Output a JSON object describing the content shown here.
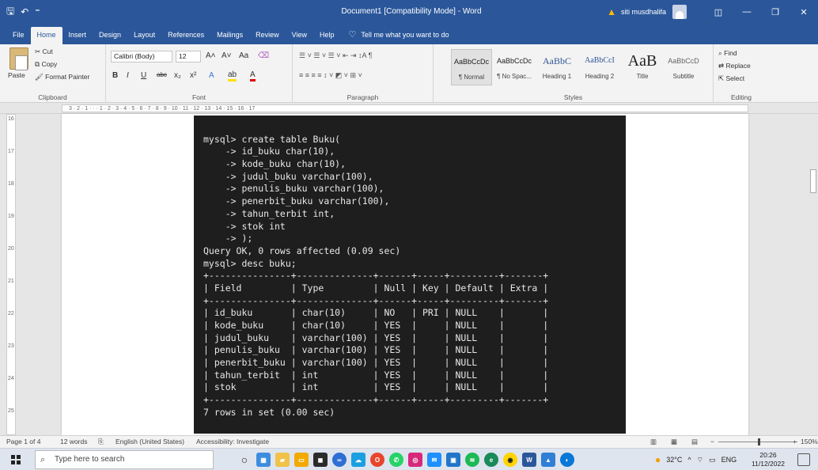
{
  "titlebar": {
    "qat_save": "🖫",
    "qat_undo": "↶",
    "qat_more": "⁼",
    "document_title": "Document1 [Compatibility Mode] - Word",
    "warning_icon": "▲",
    "user_name": "siti musdhalifa",
    "ribbon_display_icon": "◫",
    "minimize": "—",
    "restore": "❐",
    "close": "✕"
  },
  "tabs": [
    "File",
    "Home",
    "Insert",
    "Design",
    "Layout",
    "References",
    "Mailings",
    "Review",
    "View",
    "Help"
  ],
  "active_tab": "Home",
  "tellme": {
    "icon": "♡",
    "text": "Tell me what you want to do"
  },
  "comment_icon": "🗨",
  "ribbon": {
    "clipboard": {
      "paste": "Paste",
      "cut": "Cut",
      "copy": "Copy",
      "format_painter": "Format Painter",
      "label": "Clipboard"
    },
    "font": {
      "family": "Calibri (Body)",
      "size": "12",
      "grow": "A˄",
      "shrink": "A˅",
      "case": "Aa",
      "clear": "⌫",
      "bold": "B",
      "italic": "I",
      "underline": "U",
      "strike": "abc",
      "sub": "x₂",
      "sup": "x²",
      "effects": "A",
      "highlight": "ab",
      "color": "A",
      "label": "Font"
    },
    "paragraph": {
      "row1": "☰ ˅  ☰ ˅  ☰ ˅   ⇤  ⇥   ↕A   ¶",
      "row2": "≡  ≡  ≡  ≡   ↕ ˅   ◩ ˅  ⊞ ˅",
      "label": "Paragraph"
    },
    "styles": {
      "items": [
        {
          "sample": "AaBbCcDc",
          "name": "¶ Normal"
        },
        {
          "sample": "AaBbCcDc",
          "name": "¶ No Spac..."
        },
        {
          "sample": "AaBbC",
          "name": "Heading 1"
        },
        {
          "sample": "AaBbCcI",
          "name": "Heading 2"
        },
        {
          "sample": "AaB",
          "name": "Title"
        },
        {
          "sample": "AaBbCcD",
          "name": "Subtitle"
        }
      ],
      "label": "Styles"
    },
    "editing": {
      "find": "Find",
      "replace": "Replace",
      "select": "Select",
      "label": "Editing"
    }
  },
  "ruler": {
    "text": "3 · 2 · 1 ·  ·  · 1 · 2 · 3 · 4 · 5 · 6 · 7 · 8 · 9 · 10 · 11 · 12 · 13 · 14 · 15 · 16 · 17"
  },
  "vruler": [
    "16",
    "17",
    "18",
    "19",
    "20",
    "21",
    "22",
    "23",
    "24",
    "25"
  ],
  "terminal": {
    "lines": [
      "mysql> create table Buku(",
      "    -> id_buku char(10),",
      "    -> kode_buku char(10),",
      "    -> judul_buku varchar(100),",
      "    -> penulis_buku varchar(100),",
      "    -> penerbit_buku varchar(100),",
      "    -> tahun_terbit int,",
      "    -> stok int",
      "    -> );",
      "Query OK, 0 rows affected (0.09 sec)",
      "mysql> desc buku;",
      "+---------------+--------------+------+-----+---------+-------+",
      "| Field         | Type         | Null | Key | Default | Extra |",
      "+---------------+--------------+------+-----+---------+-------+",
      "| id_buku       | char(10)     | NO   | PRI | NULL    |       |",
      "| kode_buku     | char(10)     | YES  |     | NULL    |       |",
      "| judul_buku    | varchar(100) | YES  |     | NULL    |       |",
      "| penulis_buku  | varchar(100) | YES  |     | NULL    |       |",
      "| penerbit_buku | varchar(100) | YES  |     | NULL    |       |",
      "| tahun_terbit  | int          | YES  |     | NULL    |       |",
      "| stok          | int          | YES  |     | NULL    |       |",
      "+---------------+--------------+------+-----+---------+-------+",
      "7 rows in set (0.00 sec)"
    ]
  },
  "statusbar": {
    "page": "Page 1 of 4",
    "words": "12 words",
    "proof_icon": "⎘",
    "language": "English (United States)",
    "accessibility": "Accessibility: Investigate",
    "zoom_minus": "−",
    "zoom_plus": "+",
    "zoom": "150%"
  },
  "taskbar": {
    "search_placeholder": "Type here to search",
    "temperature": "32°C",
    "language": "ENG",
    "time": "20:26",
    "date": "11/12/2022",
    "tray_chevron": "^"
  },
  "colors": {
    "word_blue": "#2b579a",
    "terminal_bg": "#1e1e1e",
    "warning": "#ffb900"
  }
}
